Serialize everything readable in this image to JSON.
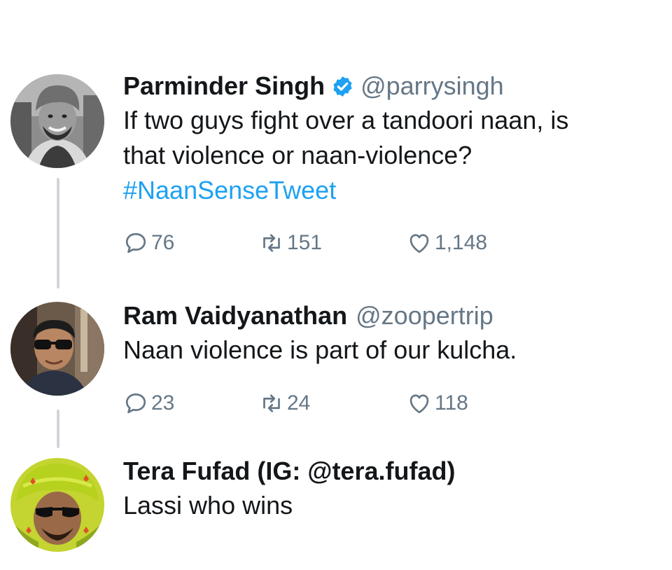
{
  "tweets": [
    {
      "name": "Parminder Singh",
      "verified": true,
      "handle": "@parrysingh",
      "text_lines": [
        "If two guys fight over a tandoori naan, is",
        "that violence or naan-violence?"
      ],
      "hashtag": "#NaanSenseTweet",
      "replies": "76",
      "retweets": "151",
      "likes": "1,148"
    },
    {
      "name": "Ram Vaidyanathan",
      "verified": false,
      "handle": "@zoopertrip",
      "text_lines": [
        "Naan violence is part of our kulcha."
      ],
      "replies": "23",
      "retweets": "24",
      "likes": "118"
    },
    {
      "name": "Tera Fufad (IG: @tera.fufad)",
      "verified": false,
      "text_lines": [
        "Lassi who wins"
      ]
    }
  ],
  "colors": {
    "text": "#14171a",
    "secondary": "#657786",
    "hashtag": "#1da1f2",
    "verified": "#1da1f2",
    "thread_line": "#cfd5da"
  },
  "icons": {
    "reply": "speech-bubble-icon",
    "retweet": "retweet-arrows-icon",
    "like": "heart-outline-icon",
    "verified": "verified-badge-icon"
  }
}
